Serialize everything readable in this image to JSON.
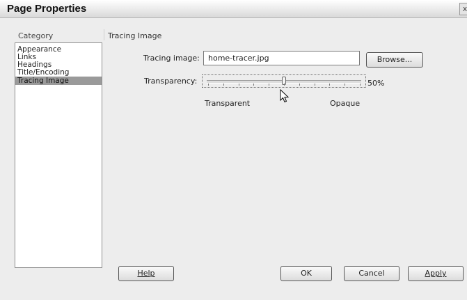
{
  "window": {
    "title": "Page Properties",
    "close_glyph": "x"
  },
  "sidebar": {
    "header": "Category",
    "items": [
      {
        "label": "Appearance",
        "selected": false
      },
      {
        "label": "Links",
        "selected": false
      },
      {
        "label": "Headings",
        "selected": false
      },
      {
        "label": "Title/Encoding",
        "selected": false
      },
      {
        "label": "Tracing Image",
        "selected": true
      }
    ]
  },
  "main": {
    "section_title": "Tracing Image",
    "tracing_image_label": "Tracing image:",
    "tracing_image_value": "home-tracer.jpg",
    "browse_label": "Browse...",
    "transparency_label": "Transparency:",
    "transparency_value_text": "50%",
    "transparency_fraction": 0.5,
    "transparent_label": "Transparent",
    "opaque_label": "Opaque"
  },
  "footer": {
    "help_label": "Help",
    "ok_label": "OK",
    "cancel_label": "Cancel",
    "apply_label": "Apply"
  },
  "colors": {
    "selected_bg": "#9a9a9a",
    "window_bg": "#ededed"
  },
  "icons": {
    "cursor": "arrow-cursor-icon",
    "close": "close-icon"
  }
}
